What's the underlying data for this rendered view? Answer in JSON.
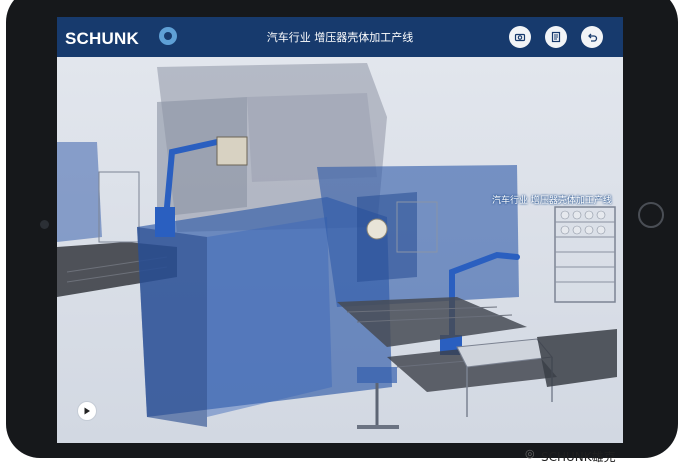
{
  "app": {
    "brand": "SCHUNK",
    "title": "汽车行业 增压器壳体加工产线"
  },
  "toolbar": {
    "icons": [
      "camera-icon",
      "document-icon",
      "back-icon"
    ]
  },
  "scene": {
    "label": "汽车行业 增压器壳体加工产线"
  },
  "watermark": {
    "text": "SCHUNK雄克"
  },
  "colors": {
    "topbar": "#173a6d",
    "accent": "#5fa0d6",
    "machine_blue": "#2f5aa8"
  }
}
